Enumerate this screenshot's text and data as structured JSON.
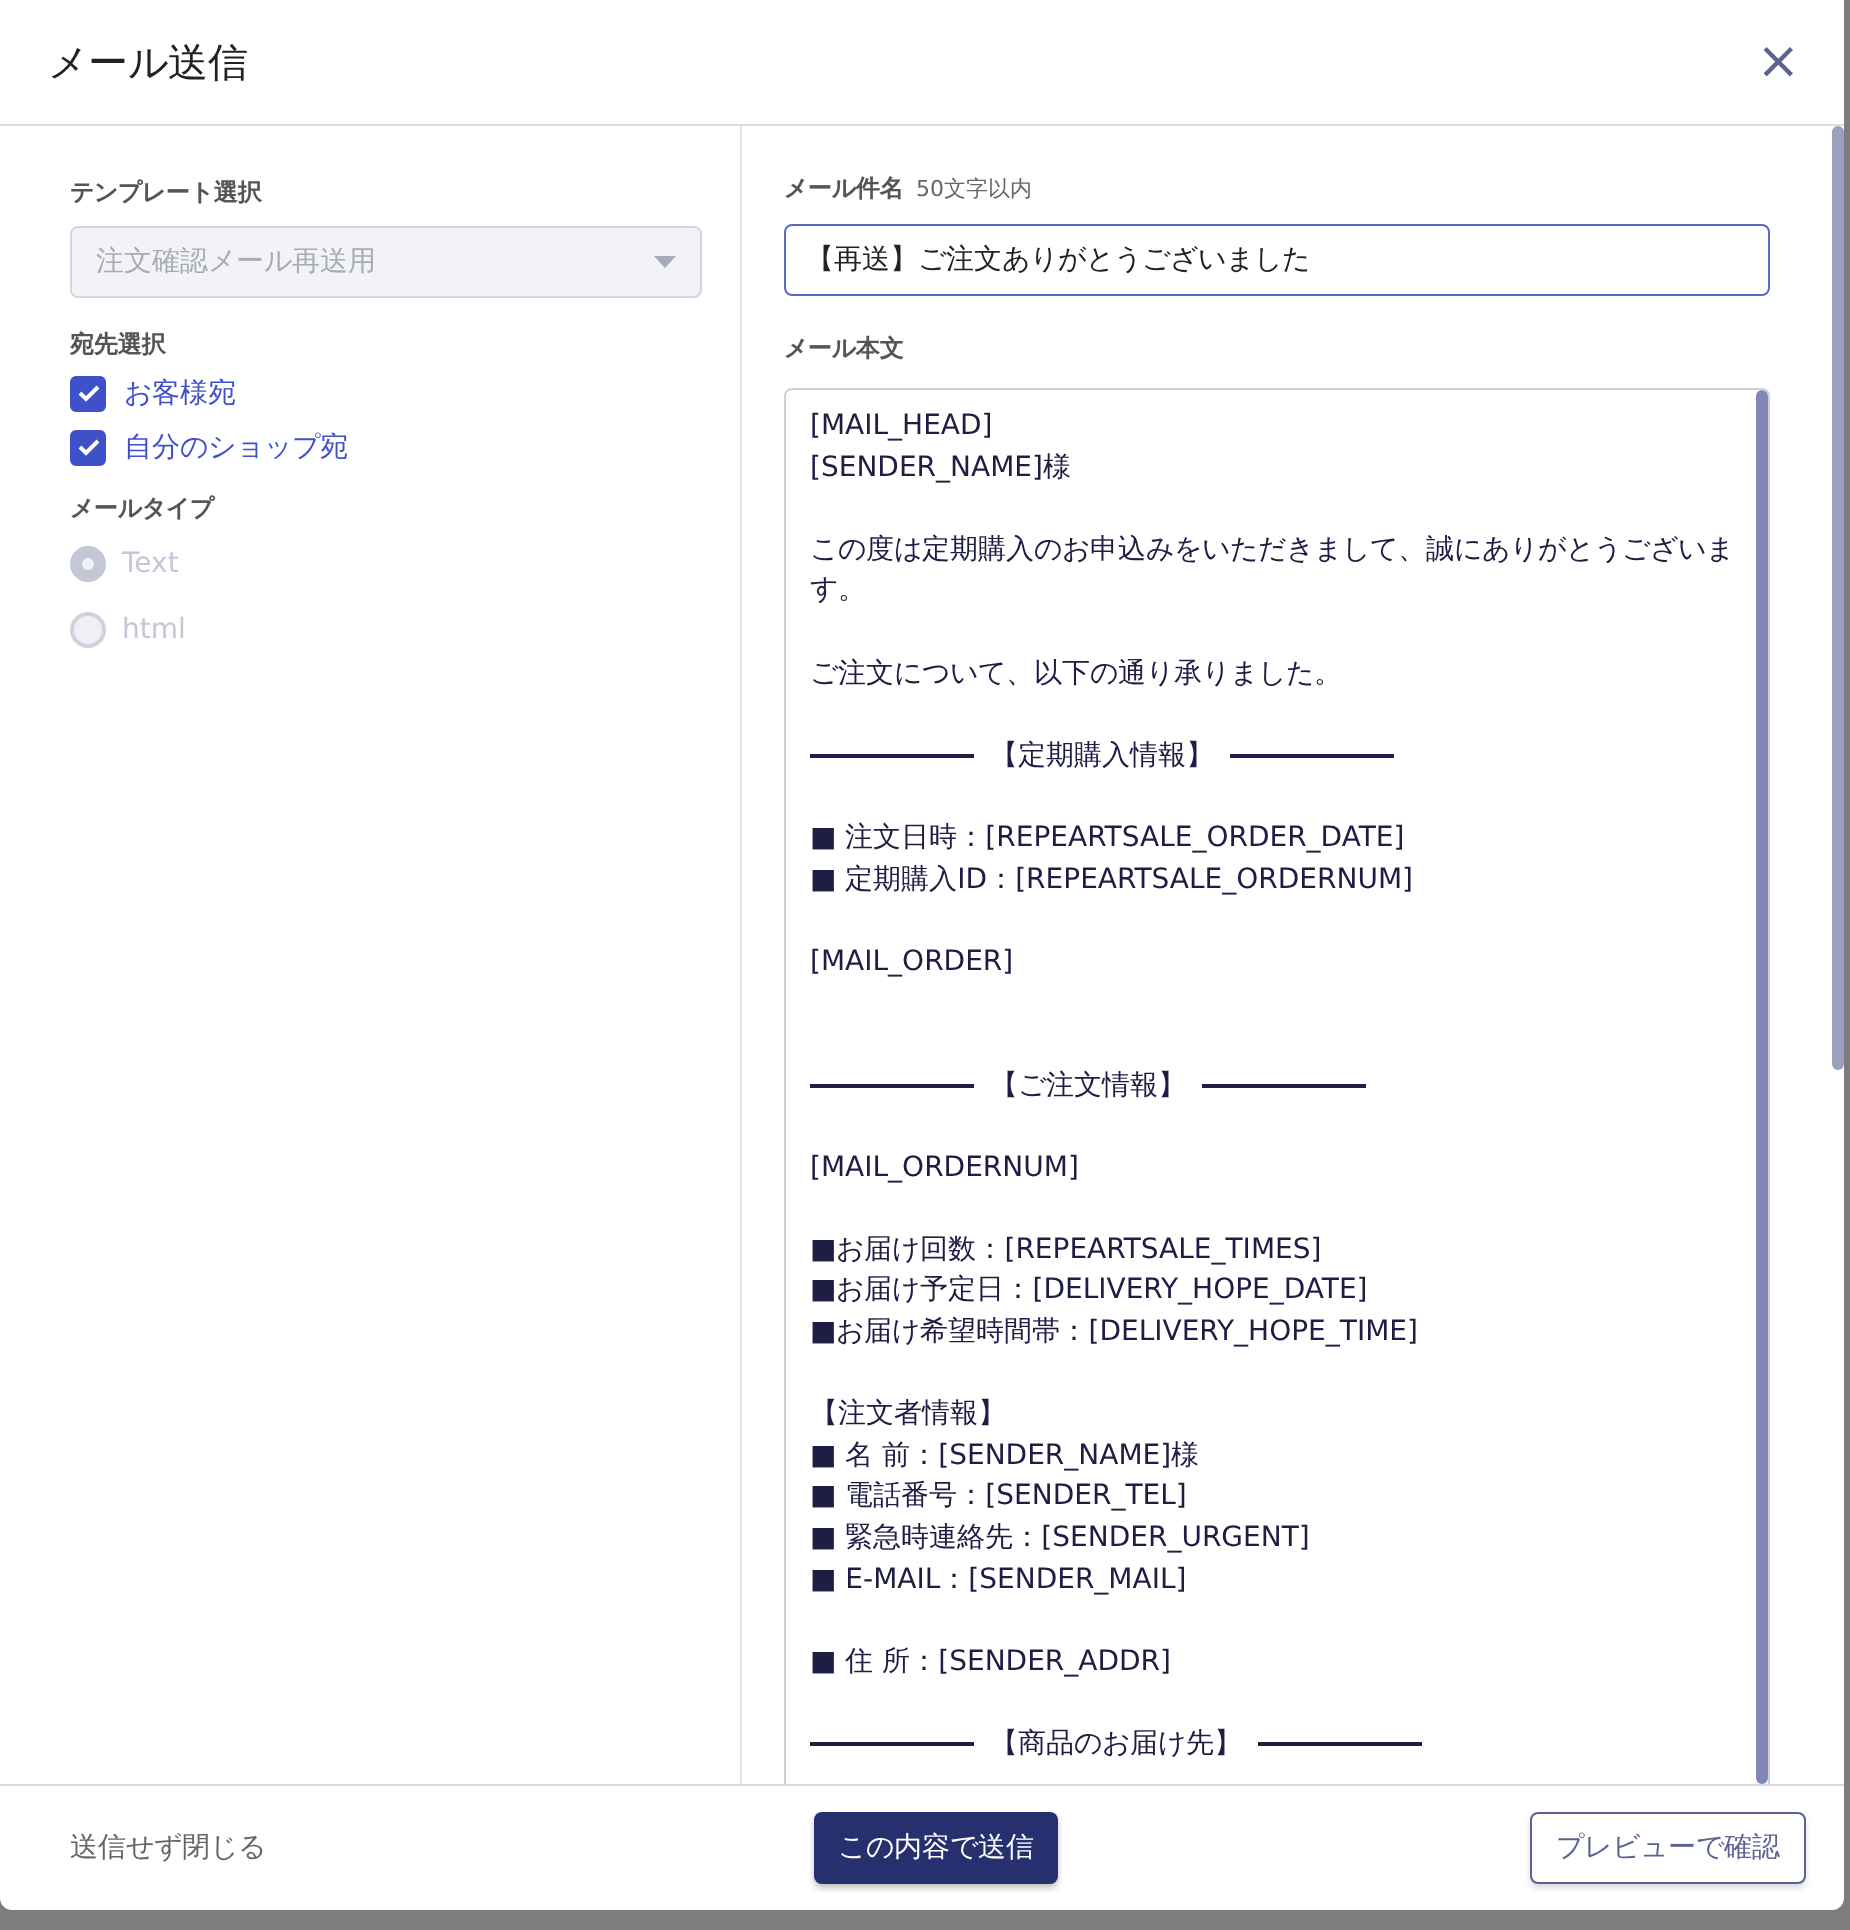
{
  "dialog": {
    "title": "メール送信",
    "close": "×"
  },
  "template": {
    "label": "テンプレート選択",
    "value": "注文確認メール再送用",
    "disabled": true
  },
  "recipients": {
    "label": "宛先選択",
    "items": [
      {
        "label": "お客様宛",
        "checked": true
      },
      {
        "label": "自分のショップ宛",
        "checked": true
      }
    ]
  },
  "mail_type": {
    "label": "メールタイプ",
    "options": [
      {
        "label": "Text",
        "selected": true,
        "disabled": true
      },
      {
        "label": "html",
        "selected": false,
        "disabled": true
      }
    ]
  },
  "subject": {
    "label": "メール件名",
    "hint": "50文字以内",
    "value": "【再送】ご注文ありがとうございました"
  },
  "body": {
    "label": "メール本文",
    "lines": [
      {
        "kind": "text",
        "text": "[MAIL_HEAD]"
      },
      {
        "kind": "text",
        "text": "[SENDER_NAME]様"
      },
      {
        "kind": "gap"
      },
      {
        "kind": "text",
        "text": "この度は定期購入のお申込みをいただきまして、誠にありがとうございます。"
      },
      {
        "kind": "gap"
      },
      {
        "kind": "text",
        "text": "ご注文について、以下の通り承りました。"
      },
      {
        "kind": "gap"
      },
      {
        "kind": "divider",
        "text": "【定期購入情報】"
      },
      {
        "kind": "gap"
      },
      {
        "kind": "text",
        "text": "■ 注文日時：[REPEARTSALE_ORDER_DATE]"
      },
      {
        "kind": "text",
        "text": "■ 定期購入ID：[REPEARTSALE_ORDERNUM]"
      },
      {
        "kind": "gap"
      },
      {
        "kind": "text",
        "text": "[MAIL_ORDER]"
      },
      {
        "kind": "gap"
      },
      {
        "kind": "gap"
      },
      {
        "kind": "divider",
        "text": "【ご注文情報】"
      },
      {
        "kind": "gap"
      },
      {
        "kind": "text",
        "text": "[MAIL_ORDERNUM]"
      },
      {
        "kind": "gap"
      },
      {
        "kind": "text",
        "text": "■お届け回数：[REPEARTSALE_TIMES]"
      },
      {
        "kind": "text",
        "text": "■お届け予定日：[DELIVERY_HOPE_DATE]"
      },
      {
        "kind": "text",
        "text": "■お届け希望時間帯：[DELIVERY_HOPE_TIME]"
      },
      {
        "kind": "gap"
      },
      {
        "kind": "text",
        "text": "【注文者情報】"
      },
      {
        "kind": "text",
        "text": "■ 名 前：[SENDER_NAME]様"
      },
      {
        "kind": "text",
        "text": "■ 電話番号：[SENDER_TEL]"
      },
      {
        "kind": "text",
        "text": "■ 緊急時連絡先：[SENDER_URGENT]"
      },
      {
        "kind": "text",
        "text": "■ E-MAIL：[SENDER_MAIL]"
      },
      {
        "kind": "gap"
      },
      {
        "kind": "text",
        "text": "■ 住 所：[SENDER_ADDR]"
      },
      {
        "kind": "gap"
      },
      {
        "kind": "divider",
        "text": "【商品のお届け先】"
      }
    ]
  },
  "footer": {
    "close_link": "送信せず閉じる",
    "send_button": "この内容で送信",
    "preview_button": "プレビューで確認"
  }
}
